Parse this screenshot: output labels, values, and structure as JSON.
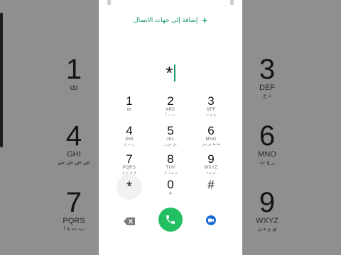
{
  "background_keys": [
    {
      "digit": "1",
      "letters": "ꝏ",
      "arabic": ""
    },
    {
      "digit": "3",
      "letters": "DEF",
      "arabic": "ذ ج"
    },
    {
      "digit": "4",
      "letters": "GHI",
      "arabic": "ص ض ش س"
    },
    {
      "digit": "6",
      "letters": "MNO",
      "arabic": "ز ج ث"
    },
    {
      "digit": "7",
      "letters": "PQRS",
      "arabic": "ب ت ة ا"
    },
    {
      "digit": "9",
      "letters": "WXYZ",
      "arabic": "ي و ه ن"
    }
  ],
  "header": {
    "add_contact_label": "إضافة إلى جهات الاتصال",
    "add_icon": "+"
  },
  "display": {
    "number": "*"
  },
  "keys": [
    {
      "digit": "1",
      "letters": "ꝏ",
      "arabic": ""
    },
    {
      "digit": "2",
      "letters": "ABC",
      "arabic": "ت ب أ"
    },
    {
      "digit": "3",
      "letters": "DEF",
      "arabic": "ج ح ث"
    },
    {
      "digit": "4",
      "letters": "GHI",
      "arabic": "ر ذ د خ"
    },
    {
      "digit": "5",
      "letters": "JKL",
      "arabic": "ش س ز"
    },
    {
      "digit": "6",
      "letters": "MNO",
      "arabic": "ظ ط ض ص"
    },
    {
      "digit": "7",
      "letters": "PQRS",
      "arabic": "ق ف غ ع"
    },
    {
      "digit": "8",
      "letters": "TUV",
      "arabic": "ن م ل ك"
    },
    {
      "digit": "9",
      "letters": "WXYZ",
      "arabic": "ي و ه"
    },
    {
      "digit": "*",
      "letters": "",
      "arabic": ""
    },
    {
      "digit": "0",
      "letters": "+",
      "arabic": ""
    },
    {
      "digit": "#",
      "letters": "",
      "arabic": ""
    }
  ],
  "colors": {
    "accent": "#1e9b6e",
    "call": "#22c063",
    "video": "#1a6bd8"
  },
  "icons": {
    "backspace": "backspace-icon",
    "call": "phone-icon",
    "video": "video-call-icon"
  }
}
